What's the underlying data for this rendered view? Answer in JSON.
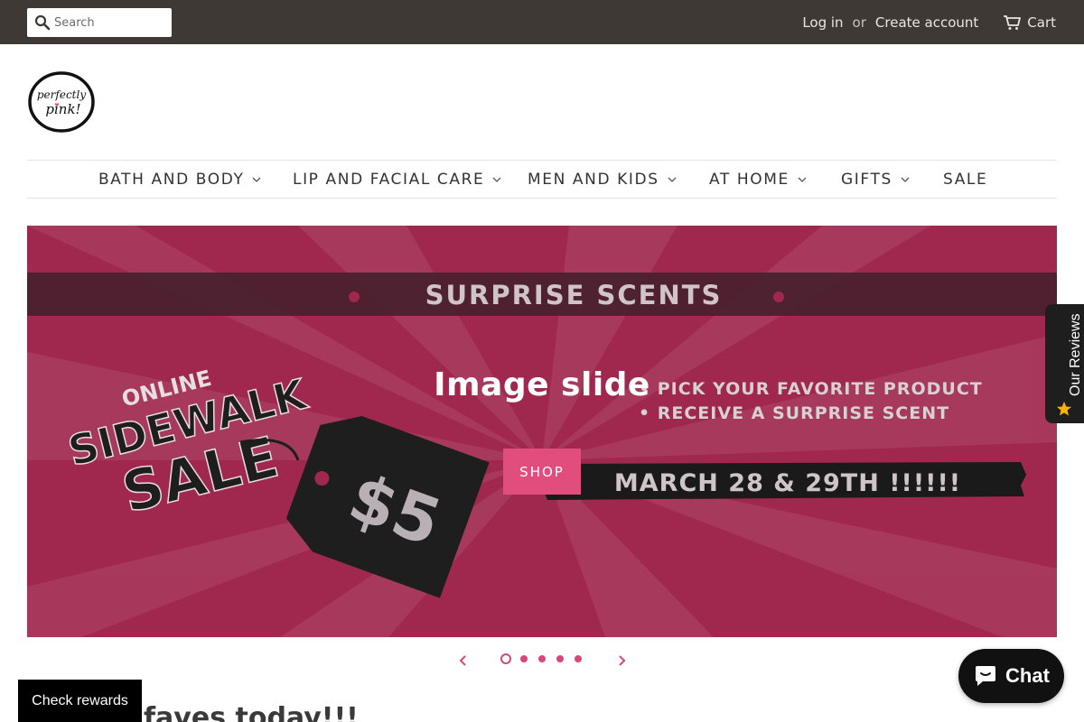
{
  "header": {
    "search_placeholder": "Search",
    "login_label": "Log in",
    "or_label": "or",
    "create_account_label": "Create account",
    "cart_label": "Cart"
  },
  "logo": {
    "text_line1": "perfectly",
    "text_line2": "pink!"
  },
  "nav": {
    "items": [
      {
        "label": "BATH AND BODY",
        "has_dropdown": true
      },
      {
        "label": "LIP AND FACIAL CARE",
        "has_dropdown": true
      },
      {
        "label": "MEN AND KIDS",
        "has_dropdown": true
      },
      {
        "label": "AT HOME",
        "has_dropdown": true
      },
      {
        "label": "GIFTS",
        "has_dropdown": true
      },
      {
        "label": "SALE",
        "has_dropdown": false
      }
    ]
  },
  "hero": {
    "banner_heading": "SURPRISE SCENTS",
    "badge_line1": "ONLINE",
    "badge_line2": "SIDEWALK",
    "badge_line3": "SALE",
    "price_tag": "$5",
    "bullet1": "• PICK YOUR FAVORITE PRODUCT",
    "bullet2": "• RECEIVE A SURPRISE SCENT",
    "dates": "MARCH 28 & 29TH !!!!!!",
    "slide_title": "Image slide",
    "shop_label": "SHOP",
    "background_color": "#a0284f",
    "accent_color": "#e14d7d"
  },
  "slider": {
    "slide_count": 5,
    "active_index": 0
  },
  "reviews_tab": {
    "label": "Our Reviews",
    "icon": "star-icon"
  },
  "rewards": {
    "label": "Check rewards"
  },
  "section": {
    "heading_fragment": "faves today!!!"
  },
  "chat": {
    "label": "Chat",
    "icon": "chat-bubble-icon"
  },
  "colors": {
    "topbar": "#3f3936",
    "pink": "#e14d7d",
    "dot": "#d7477a"
  }
}
